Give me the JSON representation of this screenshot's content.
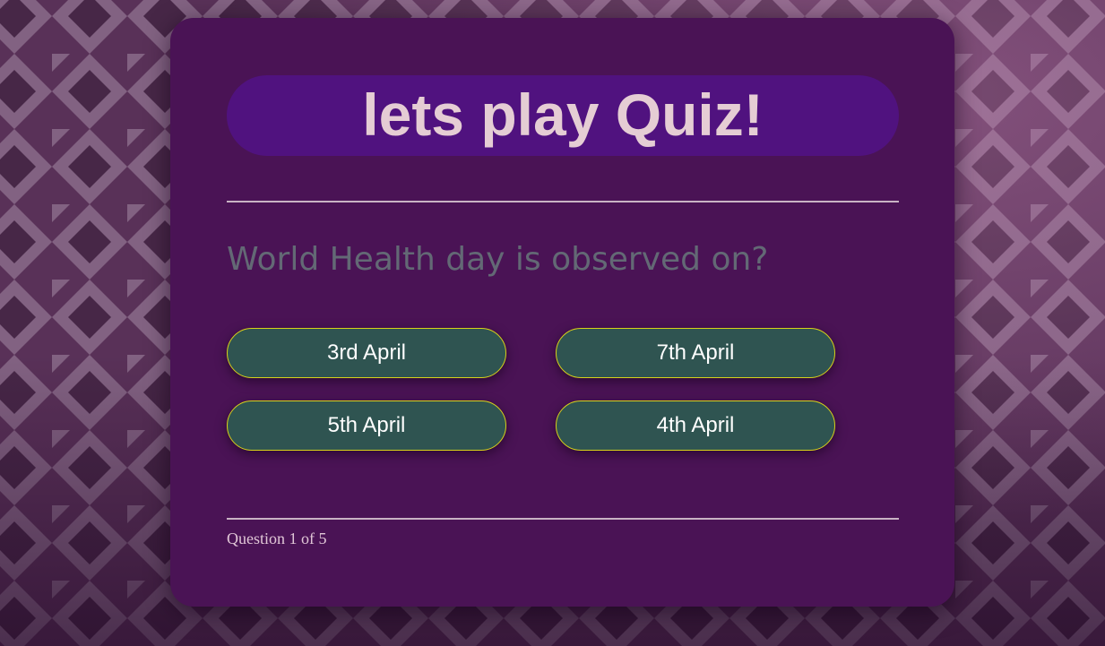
{
  "quiz": {
    "title": "lets play Quiz!",
    "question": "World Health day is observed on?",
    "answers": [
      {
        "label": "3rd April"
      },
      {
        "label": "7th April"
      },
      {
        "label": "5th April"
      },
      {
        "label": "4th April"
      }
    ],
    "progress_text": "Question 1 of 5",
    "progress": {
      "current": 1,
      "total": 5
    }
  },
  "colors": {
    "card_background": "#4a1355",
    "title_pill": "#50127f",
    "title_text": "#e5cdd4",
    "question_text": "#636975",
    "answer_background": "#2f5451",
    "answer_border": "#d7d21a",
    "answer_text": "#ffffff",
    "divider": "#c9b3c4"
  }
}
